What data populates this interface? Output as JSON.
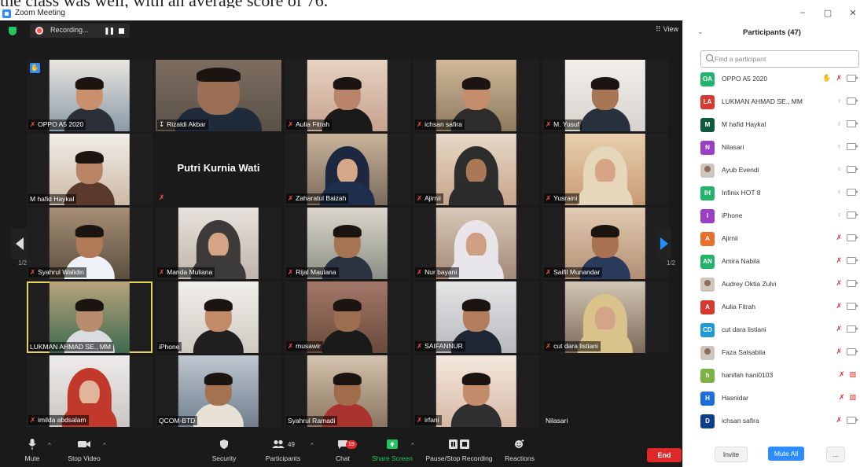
{
  "window": {
    "cropped_caption": "the class was well, with an average score of 76.",
    "title": "Zoom Meeting",
    "controls": {
      "minimize": "–",
      "maximize": "▢",
      "close": "✕"
    }
  },
  "topbar": {
    "recording_label": "Recording...",
    "pause_symbol": "❚❚",
    "view_label": "View",
    "view_icon": "⠿"
  },
  "pager": {
    "left": "1/2",
    "right": "1/2"
  },
  "tiles": [
    {
      "name": "OPPO A5 2020",
      "muted": true,
      "hand_raised": true,
      "type": "video"
    },
    {
      "name": "Rizaldi Akbar",
      "pinned": true,
      "type": "video"
    },
    {
      "name": "Aulia Fitrah",
      "muted": true,
      "type": "video"
    },
    {
      "name": "ichsan safira",
      "muted": true,
      "type": "video"
    },
    {
      "name": "M. Yusuf",
      "muted": true,
      "type": "video"
    },
    {
      "name": "M hafid Haykal",
      "muted": false,
      "type": "video"
    },
    {
      "name": "Putri Kurnia Wati",
      "muted": true,
      "type": "name_only"
    },
    {
      "name": "Zaharatul Baizah",
      "muted": true,
      "type": "video"
    },
    {
      "name": "Ajirnii",
      "muted": true,
      "type": "video"
    },
    {
      "name": "Yusraini",
      "muted": true,
      "type": "video"
    },
    {
      "name": "Syahrul Walidin",
      "muted": true,
      "type": "video"
    },
    {
      "name": "Manda Muliana",
      "muted": true,
      "type": "video"
    },
    {
      "name": "Rijal Maulana",
      "muted": true,
      "type": "video"
    },
    {
      "name": "Nur bayani",
      "muted": true,
      "type": "video"
    },
    {
      "name": "Saifil Munandar",
      "muted": true,
      "type": "video"
    },
    {
      "name": "LUKMAN AHMAD SE., MM",
      "muted": false,
      "active_speaker": true,
      "type": "video"
    },
    {
      "name": "iPhone",
      "muted": false,
      "type": "video"
    },
    {
      "name": "musawir",
      "muted": true,
      "type": "video"
    },
    {
      "name": "SAIFANNUR",
      "muted": true,
      "type": "video"
    },
    {
      "name": "cut dara listiani",
      "muted": true,
      "type": "video"
    },
    {
      "name": "imilda abdsalam",
      "muted": true,
      "type": "video"
    },
    {
      "name": "QCOM-BTD",
      "muted": false,
      "type": "video"
    },
    {
      "name": "Syahrul Ramadi",
      "muted": false,
      "type": "video"
    },
    {
      "name": "irfani",
      "muted": true,
      "type": "video"
    },
    {
      "name": "Nilasari",
      "muted": false,
      "type": "empty"
    }
  ],
  "toolbar": {
    "mute": "Mute",
    "stop_video": "Stop Video",
    "security": "Security",
    "participants": "Participants",
    "participants_count": "49",
    "chat": "Chat",
    "chat_badge": "19",
    "share_screen": "Share Screen",
    "pause_stop_recording": "Pause/Stop Recording",
    "reactions": "Reactions",
    "end": "End"
  },
  "panel": {
    "title": "Participants (47)",
    "search_placeholder": "Find a participant",
    "participants": [
      {
        "initials": "OA",
        "name": "OPPO A5 2020",
        "color": "#23b36a",
        "hand": true,
        "mic": "off",
        "cam": "on"
      },
      {
        "initials": "LA",
        "name": "LUKMAN AHMAD SE., MM",
        "color": "#d9382c",
        "mic": "on",
        "cam": "on"
      },
      {
        "initials": "M",
        "name": "M hafid Haykal",
        "color": "#0e5a3a",
        "mic": "on",
        "cam": "on"
      },
      {
        "initials": "N",
        "name": "Nilasari",
        "color": "#9a3fc6",
        "mic": "on",
        "cam": "on"
      },
      {
        "initials": "",
        "name": "Ayub Evendi",
        "color": "#7a7a7a",
        "photo": true,
        "mic": "on",
        "cam": "on"
      },
      {
        "initials": "IH",
        "name": "Infinix HOT 8",
        "color": "#23b36a",
        "mic": "on",
        "cam": "on"
      },
      {
        "initials": "I",
        "name": "iPhone",
        "color": "#9a3fc6",
        "mic": "on",
        "cam": "on"
      },
      {
        "initials": "A",
        "name": "Ajirnii",
        "color": "#e8702a",
        "mic": "off",
        "cam": "on"
      },
      {
        "initials": "AN",
        "name": "Amira Nabila",
        "color": "#23b36a",
        "mic": "off",
        "cam": "on"
      },
      {
        "initials": "",
        "name": "Audrey Oktia Zulvi",
        "color": "#cfc6be",
        "photo": true,
        "mic": "off",
        "cam": "on"
      },
      {
        "initials": "A",
        "name": "Aulia Fitrah",
        "color": "#d9382c",
        "mic": "off",
        "cam": "on"
      },
      {
        "initials": "CD",
        "name": "cut dara listiani",
        "color": "#1e9bd7",
        "mic": "off",
        "cam": "on"
      },
      {
        "initials": "",
        "name": "Faza Salsabila",
        "color": "#cfc6be",
        "photo": true,
        "mic": "off",
        "cam": "on"
      },
      {
        "initials": "h",
        "name": "hanifah hani0103",
        "color": "#7cb342",
        "mic": "off",
        "cam": "off"
      },
      {
        "initials": "H",
        "name": "Hasnidar",
        "color": "#1e6fd9",
        "mic": "off",
        "cam": "off"
      },
      {
        "initials": "D",
        "name": "ichsan safira",
        "color": "#0d3f8c",
        "mic": "off",
        "cam": "on"
      }
    ],
    "invite": "Invite",
    "mute_all": "Mute All",
    "more": "..."
  }
}
